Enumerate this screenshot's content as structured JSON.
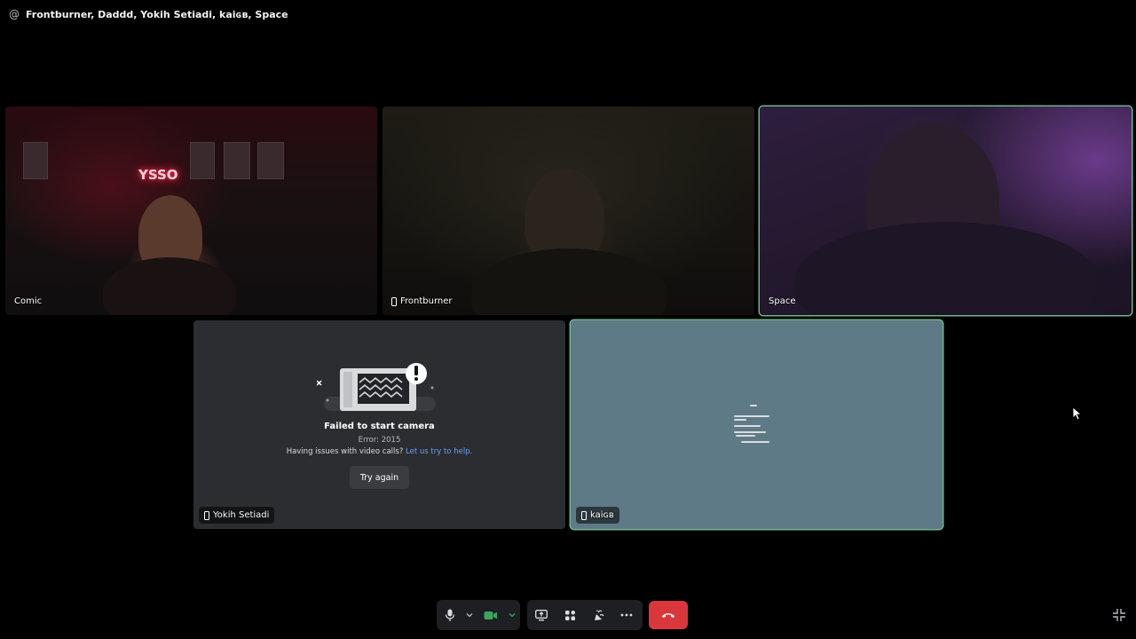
{
  "header": {
    "icon": "at-icon",
    "title": "Frontburner, Daddd, Yokih Setiadi, kaiɢʙ, Space"
  },
  "participants": [
    {
      "name": "Comic",
      "mobile": false,
      "speaking": false,
      "video": true
    },
    {
      "name": "Frontburner",
      "mobile": true,
      "speaking": false,
      "video": true
    },
    {
      "name": "Space",
      "mobile": false,
      "speaking": true,
      "video": true
    },
    {
      "name": "Yokih Setiadi",
      "mobile": true,
      "speaking": false,
      "video": false
    },
    {
      "name": "kaiɢʙ",
      "mobile": true,
      "speaking": true,
      "video": true
    }
  ],
  "camera_error": {
    "title": "Failed to start camera",
    "error_code": "Error: 2015",
    "help_text": "Having issues with video calls?",
    "help_link": "Let us try to help.",
    "retry_label": "Try again"
  },
  "neon_sign": "YSSO",
  "controls": {
    "mic": "microphone-icon",
    "mic_options": "chevron-down-icon",
    "camera": "video-camera-icon",
    "camera_options": "chevron-down-icon",
    "share_screen": "screen-share-icon",
    "activities": "activities-icon",
    "soundboard": "soundboard-icon",
    "more": "more-dots-icon",
    "disconnect": "hang-up-icon",
    "exit_fullscreen": "exit-fullscreen-icon"
  },
  "colors": {
    "background": "#000000",
    "speaking_ring": "#6fb58a",
    "hangup": "#da373c",
    "camera_on": "#3ba55c",
    "link": "#6da0f5"
  }
}
